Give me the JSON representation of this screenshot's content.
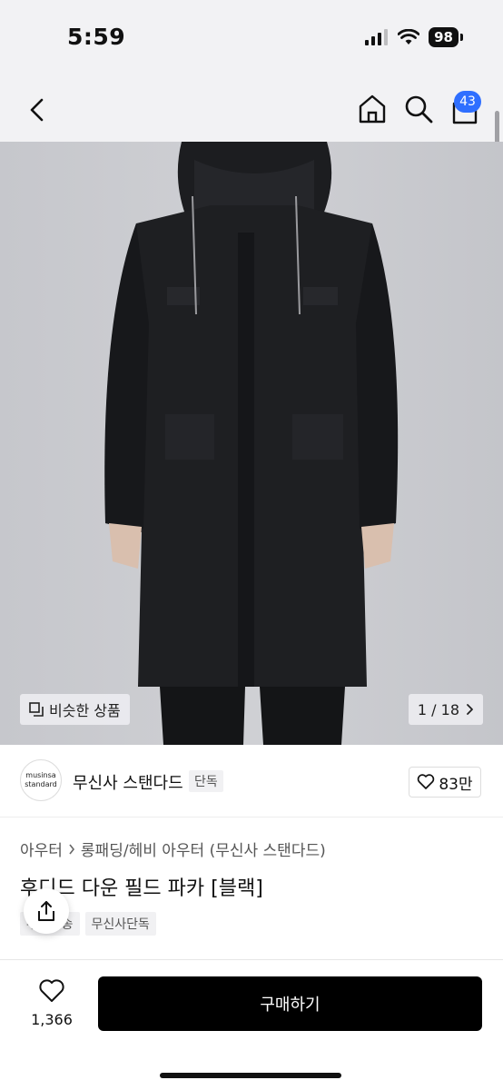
{
  "status_bar": {
    "time": "5:59",
    "battery": "98"
  },
  "nav": {
    "cart_count": "43"
  },
  "gallery": {
    "similar_label": "비슷한 상품",
    "page_indicator": "1 / 18"
  },
  "brand": {
    "logo_line1": "musinsa",
    "logo_line2": "standard",
    "name": "무신사 스탠다드",
    "exclusive_tag": "단독",
    "like_count": "83만"
  },
  "product": {
    "breadcrumb": [
      "아우터",
      "롱패딩/헤비 아우터 (무신사 스탠다드)"
    ],
    "title": "후디드 다운 필드 파카 [블랙]",
    "tags": [
      "무료배송",
      "무신사단독"
    ]
  },
  "bottom": {
    "wish_count": "1,366",
    "buy_label": "구매하기"
  },
  "colors": {
    "accent": "#2f6fff",
    "buy": "#000000",
    "image_bg": "#c9cacf"
  }
}
